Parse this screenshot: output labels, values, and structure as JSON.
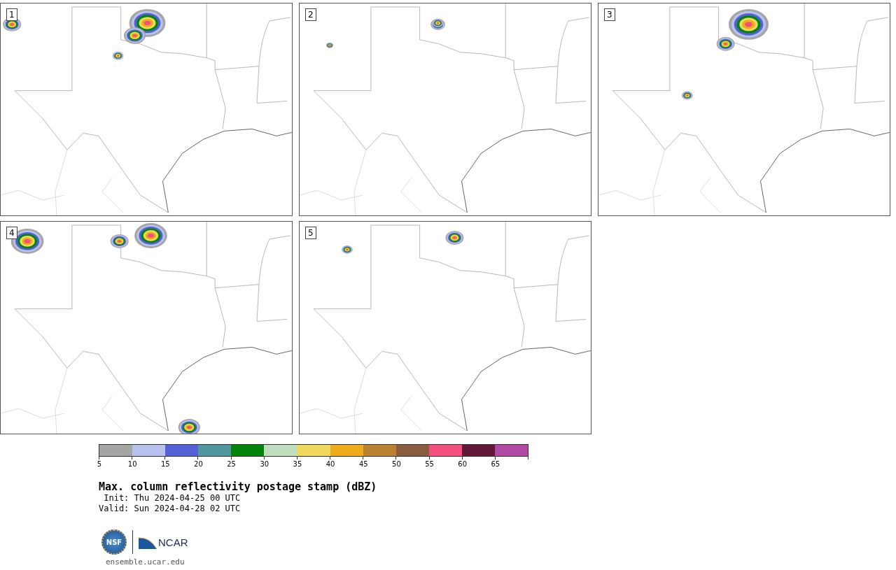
{
  "panels": [
    {
      "label": "1"
    },
    {
      "label": "2"
    },
    {
      "label": "3"
    },
    {
      "label": "4"
    },
    {
      "label": "5"
    }
  ],
  "colorbar": {
    "segments": [
      {
        "color": "#a5a5a5"
      },
      {
        "color": "#b7c3ec"
      },
      {
        "color": "#5360d6"
      },
      {
        "color": "#50979d"
      },
      {
        "color": "#02830a"
      },
      {
        "color": "#bfdec0"
      },
      {
        "color": "#eed95e"
      },
      {
        "color": "#eeab1b"
      },
      {
        "color": "#b88232"
      },
      {
        "color": "#8b5b3f"
      },
      {
        "color": "#f3507e"
      },
      {
        "color": "#621838"
      },
      {
        "color": "#b04aa4"
      }
    ],
    "ticks": [
      "5",
      "10",
      "15",
      "20",
      "25",
      "30",
      "35",
      "40",
      "45",
      "50",
      "55",
      "60",
      "65"
    ]
  },
  "title": "Max. column reflectivity postage stamp (dBZ)",
  "init": " Init: Thu 2024-04-25 00 UTC",
  "valid": "Valid: Sun 2024-04-28 02 UTC",
  "logos": {
    "nsf": "NSF",
    "ncar": "NCAR"
  },
  "website": "ensemble.ucar.edu"
}
